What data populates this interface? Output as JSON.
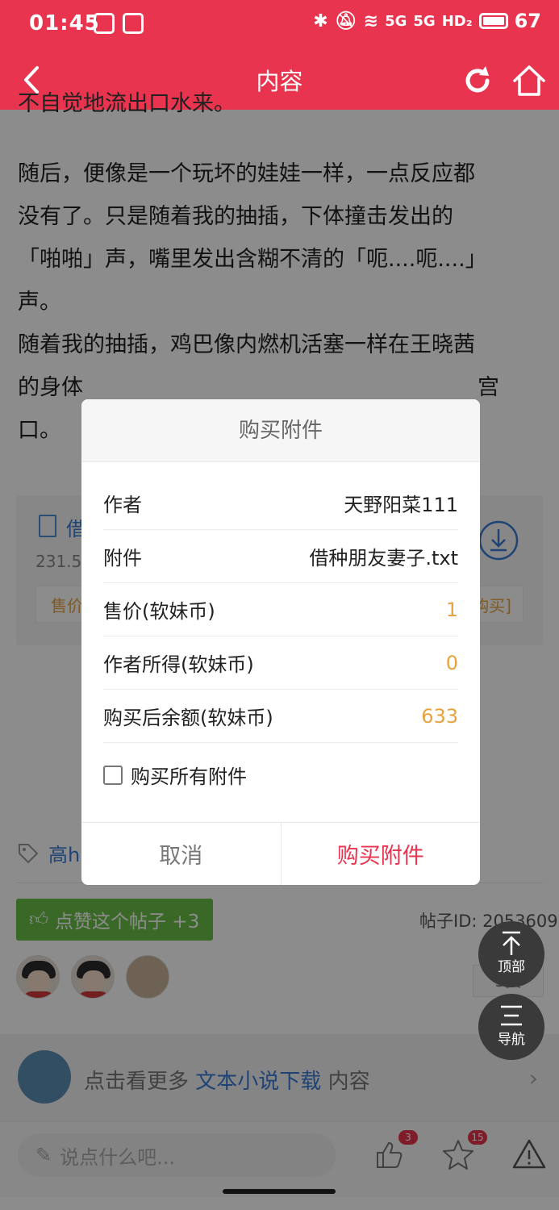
{
  "status": {
    "time": "01:45",
    "net1": "5G",
    "net2": "5G",
    "hd": "HD₂",
    "battery": "67"
  },
  "header": {
    "title": "内容"
  },
  "article": {
    "partial_line": "不自觉地流出口水来。",
    "lines": [
      "随后，便像是一个玩坏的娃娃一样，一点反应都",
      "没有了。只是随着我的抽插，下体撞击发出的",
      "「啪啪」声，嘴里发出含糊不清的「呃....呃....」",
      "声。",
      "随着我的抽插，鸡巴像内燃机活塞一样在王晓茜",
      "的身体",
      "口。"
    ],
    "fragment": "宫"
  },
  "attachment_card": {
    "name": "借",
    "size": "231.58",
    "price_label": "售价",
    "buy_link": "购买]"
  },
  "tags": {
    "text": "高h"
  },
  "post": {
    "like_label": "点赞这个帖子 +3",
    "post_id": "帖子ID: 2053609",
    "pages": "3页"
  },
  "more": {
    "prefix": "点击看更多",
    "link": "文本小说下载",
    "suffix": "内容"
  },
  "bottom": {
    "comment_placeholder": "说点什么吧...",
    "like_count": "3",
    "fav_count": "15"
  },
  "float": {
    "top_label": "顶部",
    "nav_label": "导航"
  },
  "dialog": {
    "title": "购买附件",
    "rows": [
      {
        "label": "作者",
        "value": "天野阳菜111",
        "color": "#222222"
      },
      {
        "label": "附件",
        "value": "借种朋友妻子.txt",
        "color": "#222222"
      },
      {
        "label": "售价(软妹币)",
        "value": "1",
        "color": "#e8a33d"
      },
      {
        "label": "作者所得(软妹币)",
        "value": "0",
        "color": "#e8a33d"
      },
      {
        "label": "购买后余额(软妹币)",
        "value": "633",
        "color": "#e8a33d"
      }
    ],
    "checkbox_label": "购买所有附件",
    "cancel": "取消",
    "confirm": "购买附件"
  },
  "colors": {
    "brand": "#e8344e",
    "price": "#e8a33d",
    "link": "#3a7bd5",
    "like": "#6abf48"
  }
}
